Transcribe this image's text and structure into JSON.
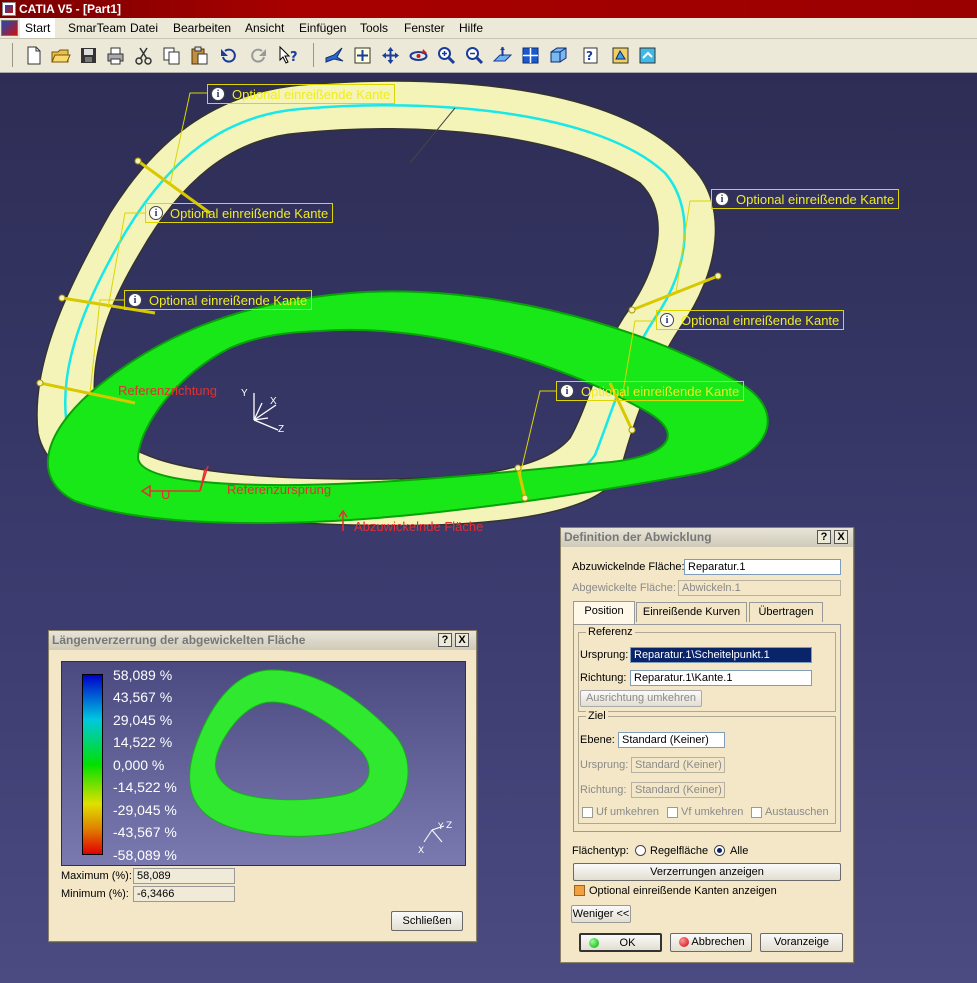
{
  "window": {
    "title": "CATIA V5 - [Part1]"
  },
  "menu": [
    "Start",
    "SmarTeam",
    "Datei",
    "Bearbeiten",
    "Ansicht",
    "Einfügen",
    "Tools",
    "Fenster",
    "Hilfe"
  ],
  "toolbar_icons": [
    "new-icon",
    "open-icon",
    "save-icon",
    "print-icon",
    "cut-icon",
    "copy-icon",
    "paste-icon",
    "undo-icon",
    "redo-icon",
    "whats-this-icon",
    "fly-mode-icon",
    "fit-all-icon",
    "pan-icon",
    "rotate-icon",
    "zoom-in-icon",
    "zoom-out-icon",
    "normal-view-icon",
    "multi-view-icon",
    "iso-view-icon",
    "view-mode-icon",
    "hide-show-icon",
    "swap-visible-icon"
  ],
  "viewport": {
    "callouts": [
      "Optional einreißende Kante",
      "Optional einreißende Kante",
      "Optional einreißende Kante",
      "Optional einreißende Kante",
      "Optional einreißende Kante",
      "Optional einreißende Kante"
    ],
    "labels": {
      "ref_direction": "Referenzrichtung",
      "ref_origin": "Referenzursprung",
      "surface_label": "Abzuwickelnde Fläche",
      "u_label": "U"
    },
    "axis": {
      "x": "X",
      "y": "Y",
      "z": "Z"
    },
    "colors": {
      "surface": "#f4f4b8",
      "unfolded": "#18e818",
      "curve": "#18e8e8",
      "callout": "#f0ec20",
      "background": "#33335e"
    }
  },
  "distortion_dialog": {
    "title": "Längenverzerrung der abgewickelten Fläche",
    "help": "?",
    "close": "X",
    "scale": [
      "58,089 %",
      "43,567 %",
      "29,045 %",
      "14,522 %",
      "0,000 %",
      "-14,522 %",
      "-29,045 %",
      "-43,567 %",
      "-58,089 %"
    ],
    "max_label": "Maximum (%):",
    "max_value": "58,089",
    "min_label": "Minimum (%):",
    "min_value": "-6,3466",
    "close_button": "Schließen",
    "axis": {
      "x": "X",
      "y": "Y",
      "z": "Z"
    }
  },
  "unfold_dialog": {
    "title": "Definition der Abwicklung",
    "help": "?",
    "close": "X",
    "surface_label": "Abzuwickelnde Fläche:",
    "surface_value": "Reparatur.1",
    "unfolded_label": "Abgewickelte Fläche:",
    "unfolded_value": "Abwickeln.1",
    "tabs": [
      "Position",
      "Einreißende Kurven",
      "Übertragen"
    ],
    "ref_group": "Referenz",
    "origin_label": "Ursprung:",
    "origin_value": "Reparatur.1\\Scheitelpunkt.1",
    "direction_label": "Richtung:",
    "direction_value": "Reparatur.1\\Kante.1",
    "reverse_button": "Ausrichtung umkehren",
    "target_group": "Ziel",
    "plane_label": "Ebene:",
    "plane_value": "Standard (Keiner)",
    "target_origin_label": "Ursprung:",
    "target_origin_value": "Standard (Keiner)",
    "target_direction_label": "Richtung:",
    "target_direction_value": "Standard (Keiner)",
    "uf_label": "Uf umkehren",
    "vf_label": "Vf umkehren",
    "swap_label": "Austauschen",
    "surface_type_label": "Flächentyp:",
    "ruled_label": "Regelfläche",
    "all_label": "Alle",
    "show_distortions": "Verzerrungen anzeigen",
    "show_edges": "Optional einreißende Kanten anzeigen",
    "less_button": "Weniger <<",
    "ok": "OK",
    "cancel": "Abbrechen",
    "preview": "Voranzeige"
  }
}
